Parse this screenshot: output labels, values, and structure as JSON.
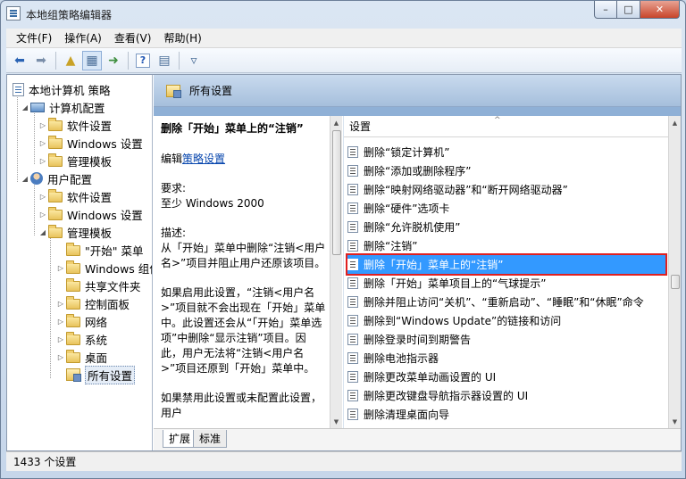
{
  "window": {
    "title": "本地组策略编辑器",
    "minimize": "–",
    "maximize": "□",
    "close": "✕"
  },
  "menu": [
    "文件(F)",
    "操作(A)",
    "查看(V)",
    "帮助(H)"
  ],
  "tree": {
    "root": "本地计算机 策略",
    "computer_config": "计算机配置",
    "cc_software": "软件设置",
    "cc_windows": "Windows 设置",
    "cc_admin": "管理模板",
    "user_config": "用户配置",
    "uc_software": "软件设置",
    "uc_windows": "Windows 设置",
    "uc_admin": "管理模板",
    "start_menu": "\"开始\" 菜单",
    "windows_components": "Windows 组件",
    "shared_folders": "共享文件夹",
    "control_panel": "控制面板",
    "network": "网络",
    "system": "系统",
    "desktop": "桌面",
    "all_settings": "所有设置"
  },
  "right": {
    "header": "所有设置",
    "description": {
      "title": "删除「开始」菜单上的“注销”",
      "edit_prefix": "编辑",
      "edit_link": "策略设置",
      "req_label": "要求:",
      "req_value": "至少 Windows 2000",
      "desc_label": "描述:",
      "desc_text": "从「开始」菜单中删除“注销<用户名>”项目并阻止用户还原该项目。",
      "desc_more": "如果启用此设置，“注销<用户名>”项目就不会出现在「开始」菜单中。此设置还会从“「开始」菜单选项”中删除“显示注销”项目。因此，用户无法将“注销<用户名>”项目还原到「开始」菜单中。",
      "desc_cut": "如果禁用此设置或未配置此设置，用户"
    },
    "list_header": "设置",
    "rows": [
      "删除“锁定计算机”",
      "删除“添加或删除程序”",
      "删除“映射网络驱动器”和“断开网络驱动器”",
      "删除“硬件”选项卡",
      "删除“允许脱机使用”",
      "删除“注销”",
      "删除「开始」菜单上的“注销”",
      "删除「开始」菜单项目上的“气球提示”",
      "删除并阻止访问“关机”、“重新启动”、“睡眠”和“休眠”命令",
      "删除到“Windows Update”的链接和访问",
      "删除登录时间到期警告",
      "删除电池指示器",
      "删除更改菜单动画设置的 UI",
      "删除更改键盘导航指示器设置的 UI",
      "删除清理桌面向导"
    ],
    "selected_row": 6,
    "tabs": [
      "扩展",
      "标准"
    ]
  },
  "status": "1433 个设置",
  "colors": {
    "selection": "#3399ff",
    "highlight_border": "#e02020",
    "header_band": "#a6bfdc"
  }
}
